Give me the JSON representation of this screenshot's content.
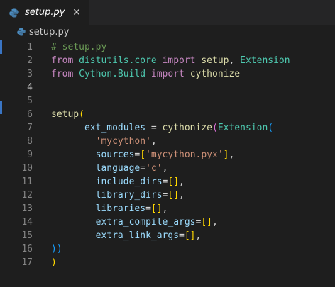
{
  "tab": {
    "filename": "setup.py",
    "close_glyph": "✕"
  },
  "breadcrumb": {
    "filename": "setup.py"
  },
  "colors": {
    "accent": "#3a75c4",
    "background": "#1e1e1e",
    "tabbar": "#252526"
  },
  "icons": {
    "file_icon": "python-icon",
    "close_icon": "close-icon"
  },
  "editor": {
    "active_line": 4,
    "lines": [
      {
        "n": "1",
        "tokens": [
          {
            "t": "# setup.py",
            "c": "comment"
          }
        ]
      },
      {
        "n": "2",
        "tokens": [
          {
            "t": "from",
            "c": "kw"
          },
          {
            "t": " ",
            "c": "plain"
          },
          {
            "t": "distutils.core",
            "c": "mod"
          },
          {
            "t": " ",
            "c": "plain"
          },
          {
            "t": "import",
            "c": "kw"
          },
          {
            "t": " ",
            "c": "plain"
          },
          {
            "t": "setup",
            "c": "fn"
          },
          {
            "t": ", ",
            "c": "plain"
          },
          {
            "t": "Extension",
            "c": "mod"
          }
        ]
      },
      {
        "n": "3",
        "tokens": [
          {
            "t": "from",
            "c": "kw"
          },
          {
            "t": " ",
            "c": "plain"
          },
          {
            "t": "Cython.Build",
            "c": "mod"
          },
          {
            "t": " ",
            "c": "plain"
          },
          {
            "t": "import",
            "c": "kw"
          },
          {
            "t": " ",
            "c": "plain"
          },
          {
            "t": "cythonize",
            "c": "fn"
          }
        ]
      },
      {
        "n": "4",
        "tokens": []
      },
      {
        "n": "5",
        "tokens": []
      },
      {
        "n": "6",
        "tokens": [
          {
            "t": "setup",
            "c": "fn"
          },
          {
            "t": "(",
            "c": "p1"
          }
        ]
      },
      {
        "n": "7",
        "tokens": [
          {
            "t": "      ",
            "c": "plain"
          },
          {
            "t": "ext_modules",
            "c": "param"
          },
          {
            "t": " = ",
            "c": "plain"
          },
          {
            "t": "cythonize",
            "c": "fn"
          },
          {
            "t": "(",
            "c": "p2"
          },
          {
            "t": "Extension",
            "c": "mod"
          },
          {
            "t": "(",
            "c": "p3"
          }
        ]
      },
      {
        "n": "8",
        "tokens": [
          {
            "t": "        ",
            "c": "plain"
          },
          {
            "t": "'mycython'",
            "c": "str"
          },
          {
            "t": ",",
            "c": "plain"
          }
        ]
      },
      {
        "n": "9",
        "tokens": [
          {
            "t": "        ",
            "c": "plain"
          },
          {
            "t": "sources",
            "c": "param"
          },
          {
            "t": "=",
            "c": "plain"
          },
          {
            "t": "[",
            "c": "p1"
          },
          {
            "t": "'mycython.pyx'",
            "c": "str"
          },
          {
            "t": "]",
            "c": "p1"
          },
          {
            "t": ",",
            "c": "plain"
          }
        ]
      },
      {
        "n": "10",
        "tokens": [
          {
            "t": "        ",
            "c": "plain"
          },
          {
            "t": "language",
            "c": "param"
          },
          {
            "t": "=",
            "c": "plain"
          },
          {
            "t": "'c'",
            "c": "str"
          },
          {
            "t": ",",
            "c": "plain"
          }
        ]
      },
      {
        "n": "11",
        "tokens": [
          {
            "t": "        ",
            "c": "plain"
          },
          {
            "t": "include_dirs",
            "c": "param"
          },
          {
            "t": "=",
            "c": "plain"
          },
          {
            "t": "[]",
            "c": "p1"
          },
          {
            "t": ",",
            "c": "plain"
          }
        ]
      },
      {
        "n": "12",
        "tokens": [
          {
            "t": "        ",
            "c": "plain"
          },
          {
            "t": "library_dirs",
            "c": "param"
          },
          {
            "t": "=",
            "c": "plain"
          },
          {
            "t": "[]",
            "c": "p1"
          },
          {
            "t": ",",
            "c": "plain"
          }
        ]
      },
      {
        "n": "13",
        "tokens": [
          {
            "t": "        ",
            "c": "plain"
          },
          {
            "t": "libraries",
            "c": "param"
          },
          {
            "t": "=",
            "c": "plain"
          },
          {
            "t": "[]",
            "c": "p1"
          },
          {
            "t": ",",
            "c": "plain"
          }
        ]
      },
      {
        "n": "14",
        "tokens": [
          {
            "t": "        ",
            "c": "plain"
          },
          {
            "t": "extra_compile_args",
            "c": "param"
          },
          {
            "t": "=",
            "c": "plain"
          },
          {
            "t": "[]",
            "c": "p1"
          },
          {
            "t": ",",
            "c": "plain"
          }
        ]
      },
      {
        "n": "15",
        "tokens": [
          {
            "t": "        ",
            "c": "plain"
          },
          {
            "t": "extra_link_args",
            "c": "param"
          },
          {
            "t": "=",
            "c": "plain"
          },
          {
            "t": "[]",
            "c": "p1"
          },
          {
            "t": ",",
            "c": "plain"
          }
        ]
      },
      {
        "n": "16",
        "tokens": [
          {
            "t": "))",
            "c": "p3"
          }
        ]
      },
      {
        "n": "17",
        "tokens": [
          {
            "t": ")",
            "c": "p1"
          }
        ]
      }
    ]
  }
}
